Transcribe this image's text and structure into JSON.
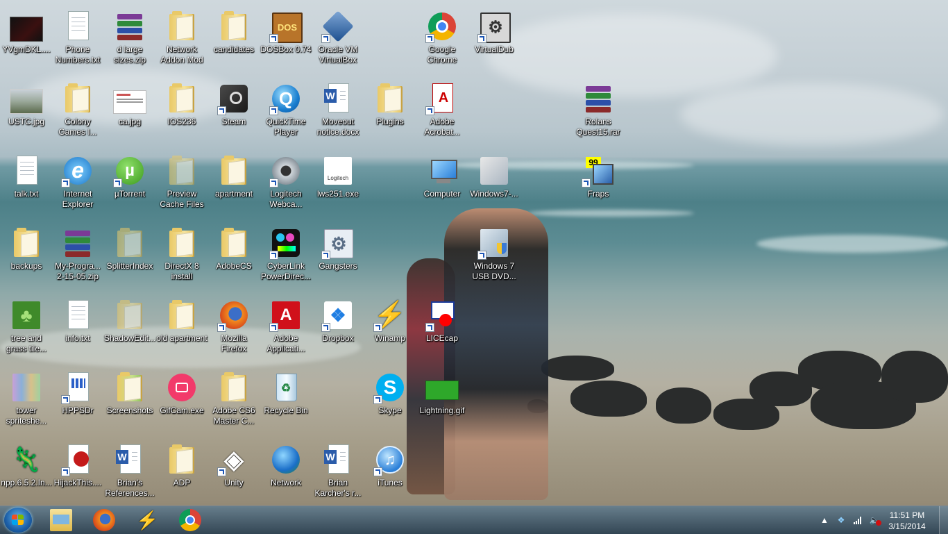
{
  "desktop": {
    "icons": [
      {
        "label": "YVgmDKL....",
        "icon": "image-thumbnail-icon"
      },
      {
        "label": "Phone Numbers.txt",
        "icon": "text-file-icon"
      },
      {
        "label": "d large sizes.zip",
        "icon": "winrar-archive-icon"
      },
      {
        "label": "Network Addon Mod",
        "icon": "folder-icon"
      },
      {
        "label": "candidates",
        "icon": "folder-icon"
      },
      {
        "label": "DOSBox 0.74",
        "icon": "dosbox-icon"
      },
      {
        "label": "Oracle VM VirtualBox",
        "icon": "virtualbox-icon"
      },
      {
        "label": "Google Chrome",
        "icon": "chrome-icon"
      },
      {
        "label": "VirtualDub",
        "icon": "virtualdub-icon"
      },
      {
        "label": "USTC.jpg",
        "icon": "image-thumbnail-icon"
      },
      {
        "label": "Colony Games I...",
        "icon": "folder-icon"
      },
      {
        "label": "ca.jpg",
        "icon": "image-thumbnail-icon"
      },
      {
        "label": "IOS236",
        "icon": "folder-icon"
      },
      {
        "label": "Steam",
        "icon": "steam-icon"
      },
      {
        "label": "QuickTime Player",
        "icon": "quicktime-icon"
      },
      {
        "label": "Moveout notice.docx",
        "icon": "word-document-icon"
      },
      {
        "label": "Plugins",
        "icon": "folder-icon"
      },
      {
        "label": "Adobe Acrobat...",
        "icon": "acrobat-icon"
      },
      {
        "label": "Rolans Quest15.rar",
        "icon": "winrar-archive-icon"
      },
      {
        "label": "talk.txt",
        "icon": "text-file-icon"
      },
      {
        "label": "Internet Explorer",
        "icon": "internet-explorer-icon"
      },
      {
        "label": "µTorrent",
        "icon": "utorrent-icon"
      },
      {
        "label": "Preview Cache Files",
        "icon": "folder-icon"
      },
      {
        "label": "apartment",
        "icon": "folder-icon"
      },
      {
        "label": "Logitech Webca...",
        "icon": "webcam-icon"
      },
      {
        "label": "lws251.exe",
        "icon": "logitech-icon"
      },
      {
        "label": "Computer",
        "icon": "computer-icon"
      },
      {
        "label": "Windows7-...",
        "icon": "windows-installer-icon"
      },
      {
        "label": "Fraps",
        "icon": "fraps-icon"
      },
      {
        "label": "backups",
        "icon": "folder-icon"
      },
      {
        "label": "My-Progra... 2-15-05.zip",
        "icon": "winrar-archive-icon"
      },
      {
        "label": "SplitterIndex",
        "icon": "folder-icon"
      },
      {
        "label": "DirectX 8 install",
        "icon": "folder-icon"
      },
      {
        "label": "AdobeCS",
        "icon": "folder-icon"
      },
      {
        "label": "CyberLink PowerDirec...",
        "icon": "cyberlink-icon"
      },
      {
        "label": "Gangsters",
        "icon": "gear-icon"
      },
      {
        "label": "Windows 7 USB DVD...",
        "icon": "usb-dvd-tool-icon"
      },
      {
        "label": "tree and grass tile...",
        "icon": "tree-image-icon"
      },
      {
        "label": "info.txt",
        "icon": "text-file-icon"
      },
      {
        "label": "ShadowEdit...",
        "icon": "folder-icon"
      },
      {
        "label": "old apartment",
        "icon": "folder-icon"
      },
      {
        "label": "Mozilla Firefox",
        "icon": "firefox-icon"
      },
      {
        "label": "Adobe Applicati...",
        "icon": "adobe-icon"
      },
      {
        "label": "Dropbox",
        "icon": "dropbox-icon"
      },
      {
        "label": "Winamp",
        "icon": "winamp-icon"
      },
      {
        "label": "LICEcap",
        "icon": "licecap-icon"
      },
      {
        "label": "tower spriteshe...",
        "icon": "sprite-image-icon"
      },
      {
        "label": "HPPSDr",
        "icon": "hp-app-icon"
      },
      {
        "label": "Screenshots",
        "icon": "folder-icon"
      },
      {
        "label": "GifCam.exe",
        "icon": "gifcam-icon"
      },
      {
        "label": "Adobe CS6 Master C...",
        "icon": "folder-icon"
      },
      {
        "label": "Recycle Bin",
        "icon": "recycle-bin-icon"
      },
      {
        "label": "Skype",
        "icon": "skype-icon"
      },
      {
        "label": "Lightning.gif",
        "icon": "gif-image-icon"
      },
      {
        "label": "npp.6.5.2.In...",
        "icon": "notepad-plus-plus-icon"
      },
      {
        "label": "HijackThis....",
        "icon": "hijackthis-icon"
      },
      {
        "label": "Brian's References...",
        "icon": "word-document-icon"
      },
      {
        "label": "ADP",
        "icon": "folder-icon"
      },
      {
        "label": "Unity",
        "icon": "unity-icon"
      },
      {
        "label": "Network",
        "icon": "network-icon"
      },
      {
        "label": "Brian Karcher's r...",
        "icon": "word-document-icon"
      },
      {
        "label": "iTunes",
        "icon": "itunes-icon"
      }
    ]
  },
  "taskbar": {
    "start_button": "windows-start-icon",
    "pinned": [
      {
        "name": "Windows Explorer",
        "icon": "explorer-folder-icon"
      },
      {
        "name": "Mozilla Firefox",
        "icon": "firefox-icon"
      },
      {
        "name": "Winamp",
        "icon": "winamp-icon"
      },
      {
        "name": "Google Chrome",
        "icon": "chrome-icon"
      }
    ],
    "tray": {
      "icons": [
        "show-hidden-icons-arrow",
        "dropbox-tray-icon",
        "network-signal-icon",
        "volume-muted-icon"
      ],
      "time": "11:51 PM",
      "date": "3/15/2014"
    }
  },
  "colors": {
    "taskbar": "#3a5566",
    "label_text": "#ffffff",
    "start_orb": "#1c5fa8"
  }
}
